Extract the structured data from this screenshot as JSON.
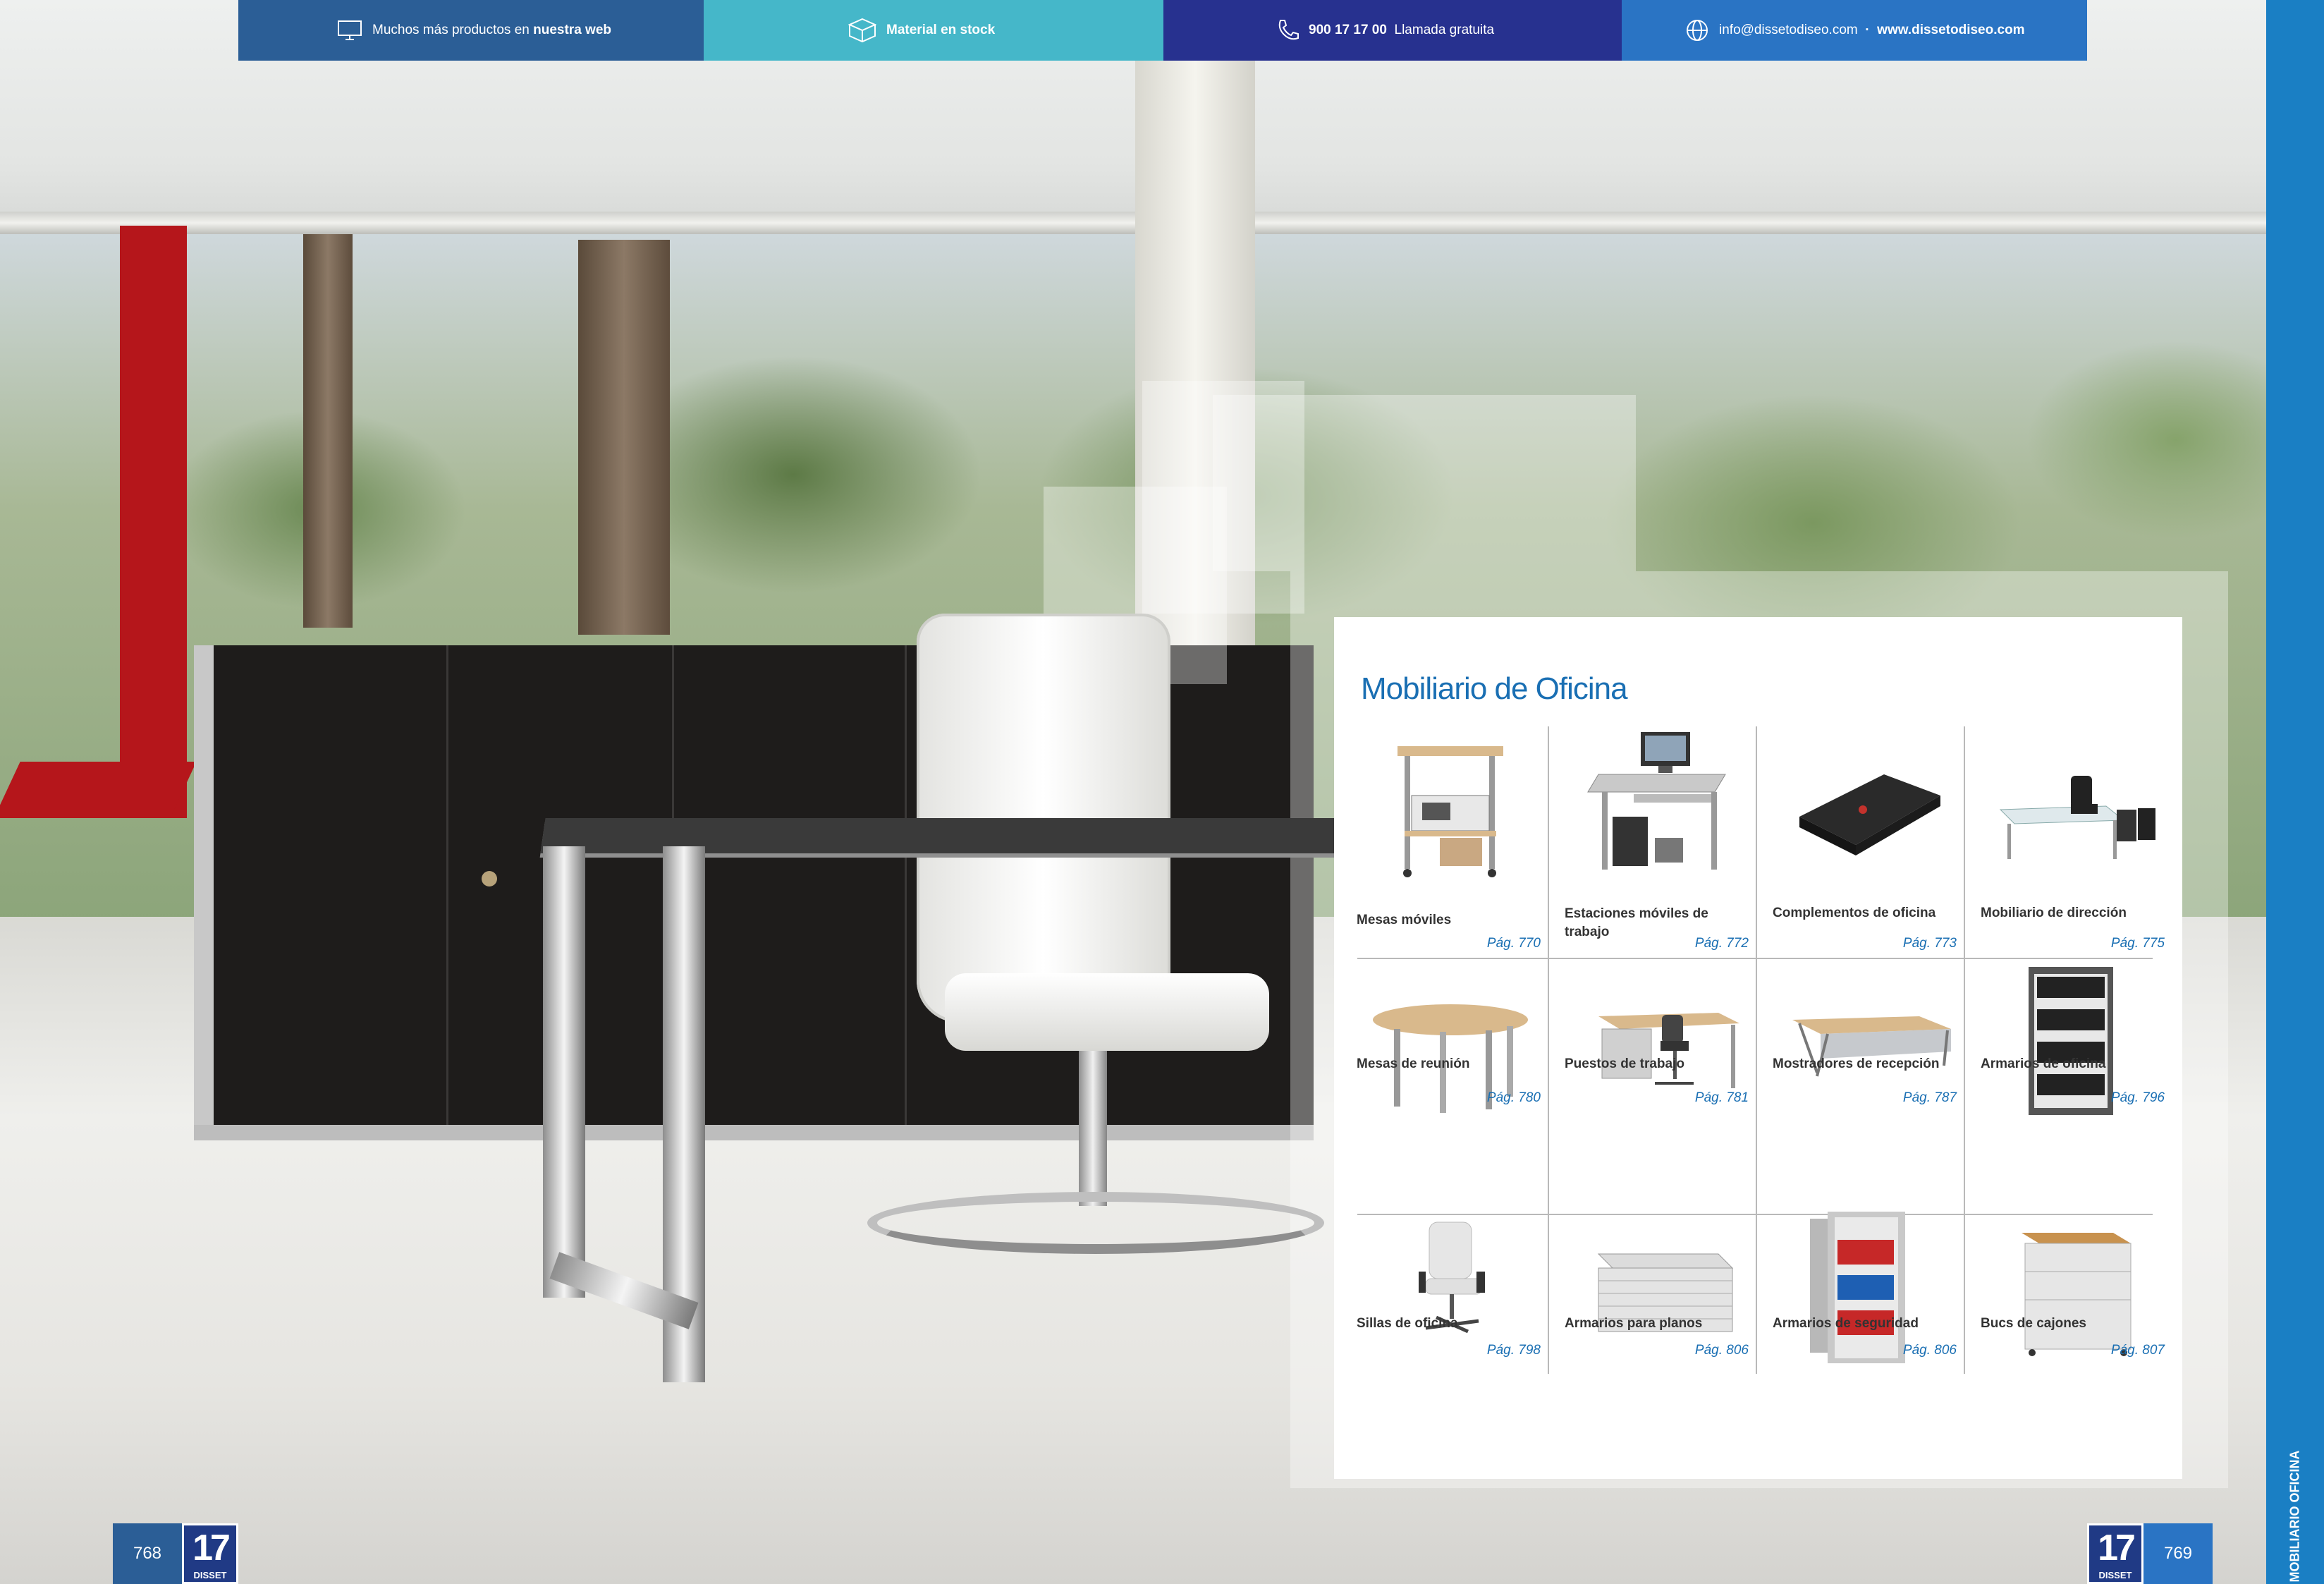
{
  "section": {
    "title": "Mobiliario de Oficina",
    "side_label": "MOBILIARIO OFICINA"
  },
  "products": [
    {
      "name": "Mesas móviles",
      "page": "Pág. 770"
    },
    {
      "name": "Estaciones móviles de trabajo",
      "page": "Pág. 772"
    },
    {
      "name": "Complementos de oficina",
      "page": "Pág. 773"
    },
    {
      "name": "Mobiliario de dirección",
      "page": "Pág. 775"
    },
    {
      "name": "Mesas de reunión",
      "page": "Pág. 780"
    },
    {
      "name": "Puestos de trabajo",
      "page": "Pág. 781"
    },
    {
      "name": "Mostradores de recepción",
      "page": "Pág. 787"
    },
    {
      "name": "Armarios de oficina",
      "page": "Pág. 796"
    },
    {
      "name": "Sillas de oficina",
      "page": "Pág. 798"
    },
    {
      "name": "Armarios para planos",
      "page": "Pág. 806"
    },
    {
      "name": "Armarios de seguridad",
      "page": "Pág. 806"
    },
    {
      "name": "Bucs de cajones",
      "page": "Pág. 807"
    }
  ],
  "footer": {
    "page_left": "768",
    "page_right": "769",
    "logo_number": "17",
    "logo_brand": "DISSET",
    "web_prefix": "Muchos más productos en",
    "web_bold": "nuestra web",
    "stock": "Material en stock",
    "phone_number": "900 17 17 00",
    "phone_note": "Llamada gratuita",
    "email": "info@dissetodiseo.com",
    "separator": "·",
    "website": "www.dissetodiseo.com"
  },
  "colors": {
    "accent_blue": "#1a6fb3",
    "side_tab": "#1a7fc4",
    "footer_web": "#2b5e96",
    "footer_stock": "#45b7c9",
    "footer_phone": "#27318f",
    "footer_contact": "#2a74c4"
  }
}
